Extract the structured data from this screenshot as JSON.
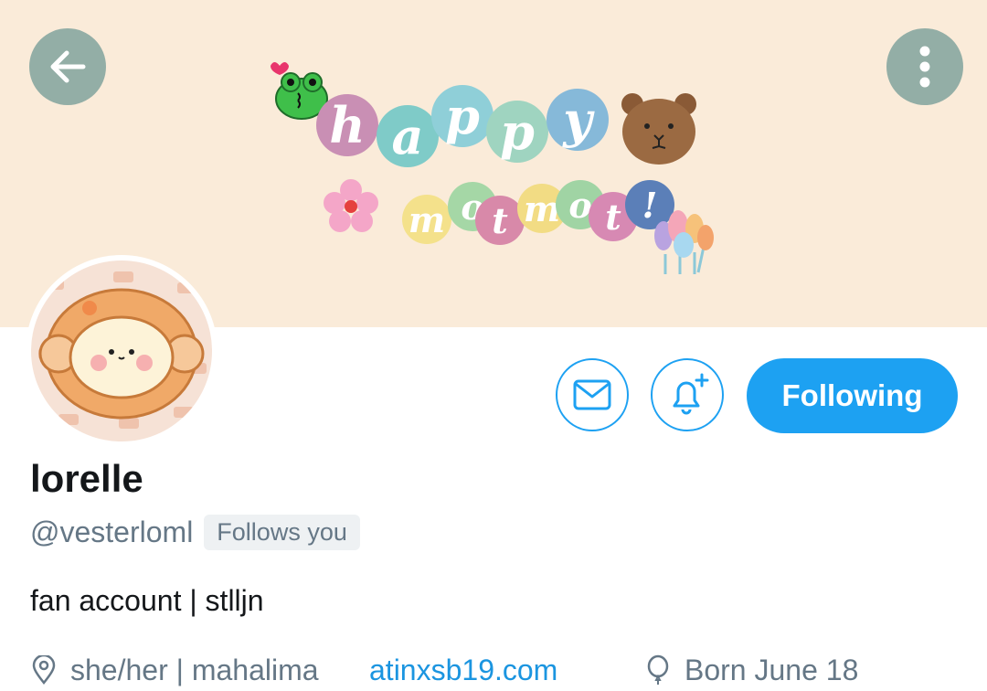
{
  "header": {
    "banner_letters_top": [
      "h",
      "a",
      "p",
      "p",
      "y"
    ],
    "banner_letters_bottom": [
      "m",
      "o",
      "t",
      "m",
      "o",
      "t",
      "!"
    ],
    "banner_colors_top": [
      "#c98fb4",
      "#7fcbc8",
      "#8fcfd8",
      "#9fd4c0",
      "#86b9d9"
    ],
    "banner_colors_bottom": [
      "#f4e18b",
      "#a5d7a6",
      "#d889a9",
      "#f2dc84",
      "#a0d4a4",
      "#d789b3",
      "#5b7fb8"
    ],
    "back_icon": "arrow-left-icon",
    "more_icon": "more-vertical-icon"
  },
  "actions": {
    "message_icon": "envelope-icon",
    "notify_icon": "bell-plus-icon",
    "follow_label": "Following"
  },
  "profile": {
    "display_name": "lorelle",
    "handle": "@vesterloml",
    "follows_you": "Follows you",
    "bio": "fan account | stlljn",
    "location": "she/her | mahalima",
    "website": "atinxsb19.com",
    "birthday": "Born June 18"
  },
  "colors": {
    "accent": "#1da1f2",
    "banner_bg": "#faebd9",
    "round_button": "#93aea6",
    "secondary_text": "#657786"
  }
}
